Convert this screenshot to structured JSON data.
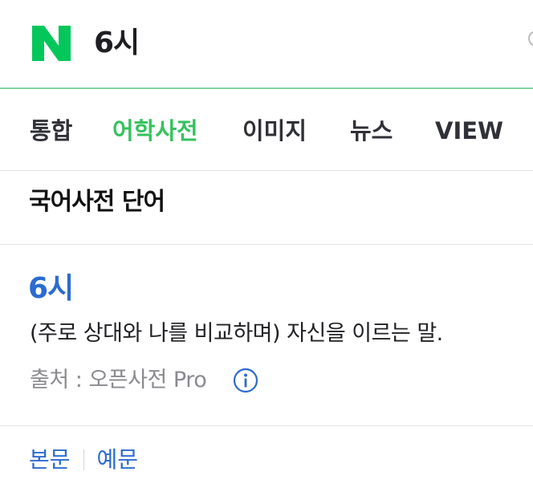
{
  "search": {
    "query": "6시"
  },
  "tabs": [
    {
      "label": "통합",
      "active": false
    },
    {
      "label": "어학사전",
      "active": true
    },
    {
      "label": "이미지",
      "active": false
    },
    {
      "label": "뉴스",
      "active": false
    },
    {
      "label": "VIEW",
      "active": false
    }
  ],
  "section": {
    "title": "국어사전 단어"
  },
  "entry": {
    "word": "6시",
    "definition": "(주로 상대와 나를 비교하며) 자신을 이르는 말.",
    "source": "출처 : 오픈사전 Pro"
  },
  "links": {
    "main_text": "본문",
    "example": "예문"
  },
  "colors": {
    "brand_green": "#03c75a",
    "active_tab": "#35c25e",
    "link_blue": "#2c6bd1"
  },
  "icons": {
    "logo": "naver-logo",
    "info": "info-circle-icon"
  }
}
